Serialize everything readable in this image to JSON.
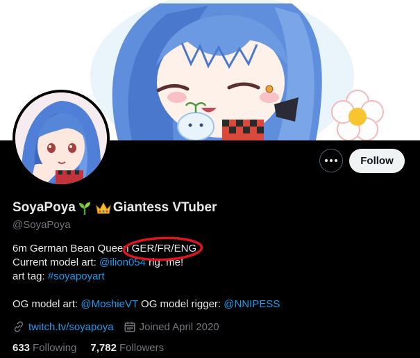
{
  "profile": {
    "display_name": "SoyaPoya",
    "display_name_suffix": "Giantess VTuber",
    "handle": "@SoyaPoya",
    "sprout_emoji": "sprout-icon",
    "crown_emoji": "crown-icon"
  },
  "actions": {
    "more_icon": "more-icon",
    "follow_label": "Follow"
  },
  "bio": {
    "line1_text": "6m German Bean Queen ",
    "line1_langs": "GER/FR/ENG",
    "line2_prefix": "Current model art: ",
    "line2_link": "@ilion054",
    "line2_suffix": " rig: me!",
    "line3_prefix": "art tag: ",
    "line3_link": "#soyapoyart",
    "line4_prefix": "OG model art: ",
    "line4_link1": "@MoshieVT",
    "line4_mid": " OG model rigger: ",
    "line4_link2": "@NNIPESS"
  },
  "meta": {
    "website": "twitch.tv/soyapoya",
    "joined": "Joined April 2020"
  },
  "stats": {
    "following_count": "633",
    "following_label": "Following",
    "followers_count": "7,782",
    "followers_label": "Followers"
  },
  "colors": {
    "background": "#000000",
    "text": "#e7e9ea",
    "secondary": "#71767b",
    "link": "#1d9bf0",
    "follow_bg": "#eff3f4",
    "annotation": "#e0141e"
  }
}
